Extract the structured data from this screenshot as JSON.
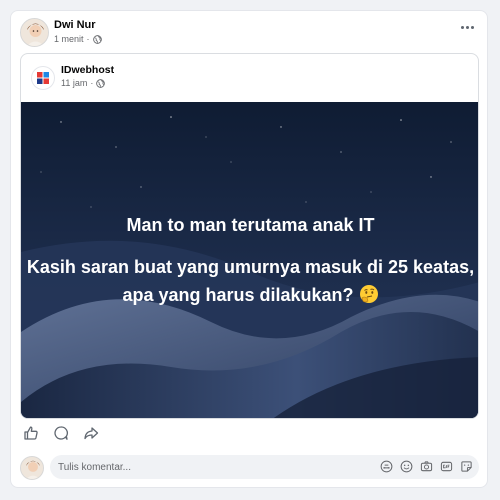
{
  "post": {
    "author": "Dwi Nur",
    "time": "1 menit",
    "sep": "·",
    "audience_icon": "globe-icon",
    "more_icon": "more-horizontal-icon"
  },
  "shared": {
    "author": "IDwebhost",
    "time": "11 jam",
    "sep": "·",
    "audience_icon": "globe-icon",
    "logo_colors": [
      "#e53935",
      "#1e88e5",
      "#1e3a8a"
    ]
  },
  "image": {
    "headline": "Man to man terutama anak IT",
    "body": "Kasih saran buat yang umurnya masuk di 25 keatas, apa yang harus dilakukan?",
    "emoji": "thinking-face-emoji",
    "bg_colors": [
      "#0f1c33",
      "#2c4066",
      "#5d6f93"
    ]
  },
  "actions": [
    {
      "icon": "like-icon"
    },
    {
      "icon": "comment-icon"
    },
    {
      "icon": "share-icon"
    }
  ],
  "comment": {
    "placeholder": "Tulis komentar...",
    "icons": [
      "avatar-sticker-icon",
      "emoji-icon",
      "camera-icon",
      "gif-icon",
      "sticker-icon"
    ]
  }
}
